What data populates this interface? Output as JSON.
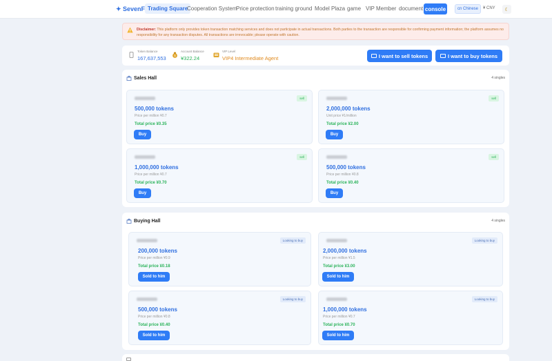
{
  "nav": {
    "logo": "✦ SevenFa",
    "items": [
      "Trading Square",
      "Cooperation System",
      "Price protection",
      "training ground",
      "Model Plaza",
      "game",
      "VIP Member",
      "document"
    ],
    "console": "console",
    "language": "cn Chinese",
    "currency": "¥ CNY",
    "theme_icon": "☾"
  },
  "disclaimer": {
    "label": "Disclaimer:",
    "text": " This platform only provides token transaction matching services and does not participate in actual transactions. Both parties to the transaction are responsible for confirming payment information; the platform assumes no responsibility for any transaction disputes. All transactions are irrevocable; please operate with caution."
  },
  "account": {
    "token_balance_label": "Token Balance",
    "token_balance": "167,637,553",
    "account_balance_label": "Account Balance",
    "account_balance": "¥322.24",
    "vip_label": "VIP Level",
    "vip_level": "VIP4 Intermediate Agent",
    "sell_button": "I want to sell tokens",
    "buy_button": "I want to buy tokens"
  },
  "sales_hall": {
    "title": "Sales Hall",
    "count": "4 singles",
    "cards": [
      {
        "badge": "sell",
        "tokens": "500,000 tokens",
        "price": "Price per million ¥0.7",
        "total": "Total price ¥0.35",
        "action": "Buy"
      },
      {
        "badge": "sell",
        "tokens": "2,000,000 tokens",
        "price": "Unit price ¥1/million",
        "total": "Total price ¥2.00",
        "action": "Buy"
      },
      {
        "badge": "sell",
        "tokens": "1,000,000 tokens",
        "price": "Price per million ¥0.7",
        "total": "Total price ¥0.70",
        "action": "Buy"
      },
      {
        "badge": "sell",
        "tokens": "500,000 tokens",
        "price": "Price per million ¥0.8",
        "total": "Total price ¥0.40",
        "action": "Buy"
      }
    ]
  },
  "buying_hall": {
    "title": "Buying Hall",
    "count": "4 singles",
    "cards": [
      {
        "badge": "Looking to buy",
        "tokens": "200,000 tokens",
        "price": "Price per million ¥0.9",
        "total": "Total price ¥0.18",
        "action": "Sold to him"
      },
      {
        "badge": "Looking to buy",
        "tokens": "2,000,000 tokens",
        "price": "Price per million ¥1.5",
        "total": "Total price ¥3.00",
        "action": "Sold to him"
      },
      {
        "badge": "Looking to buy",
        "tokens": "500,000 tokens",
        "price": "Price per million ¥0.8",
        "total": "Total price ¥0.40",
        "action": "Sold to him"
      },
      {
        "badge": "Looking to buy",
        "tokens": "1,000,000 tokens",
        "price": "Price per million ¥0.7",
        "total": "Total price ¥0.70",
        "action": "Sold to him"
      }
    ]
  },
  "colors": {
    "accent": "#2f7cf6",
    "green": "#2bb35a",
    "vip": "#e08a1e",
    "background": "#eef2f8"
  }
}
